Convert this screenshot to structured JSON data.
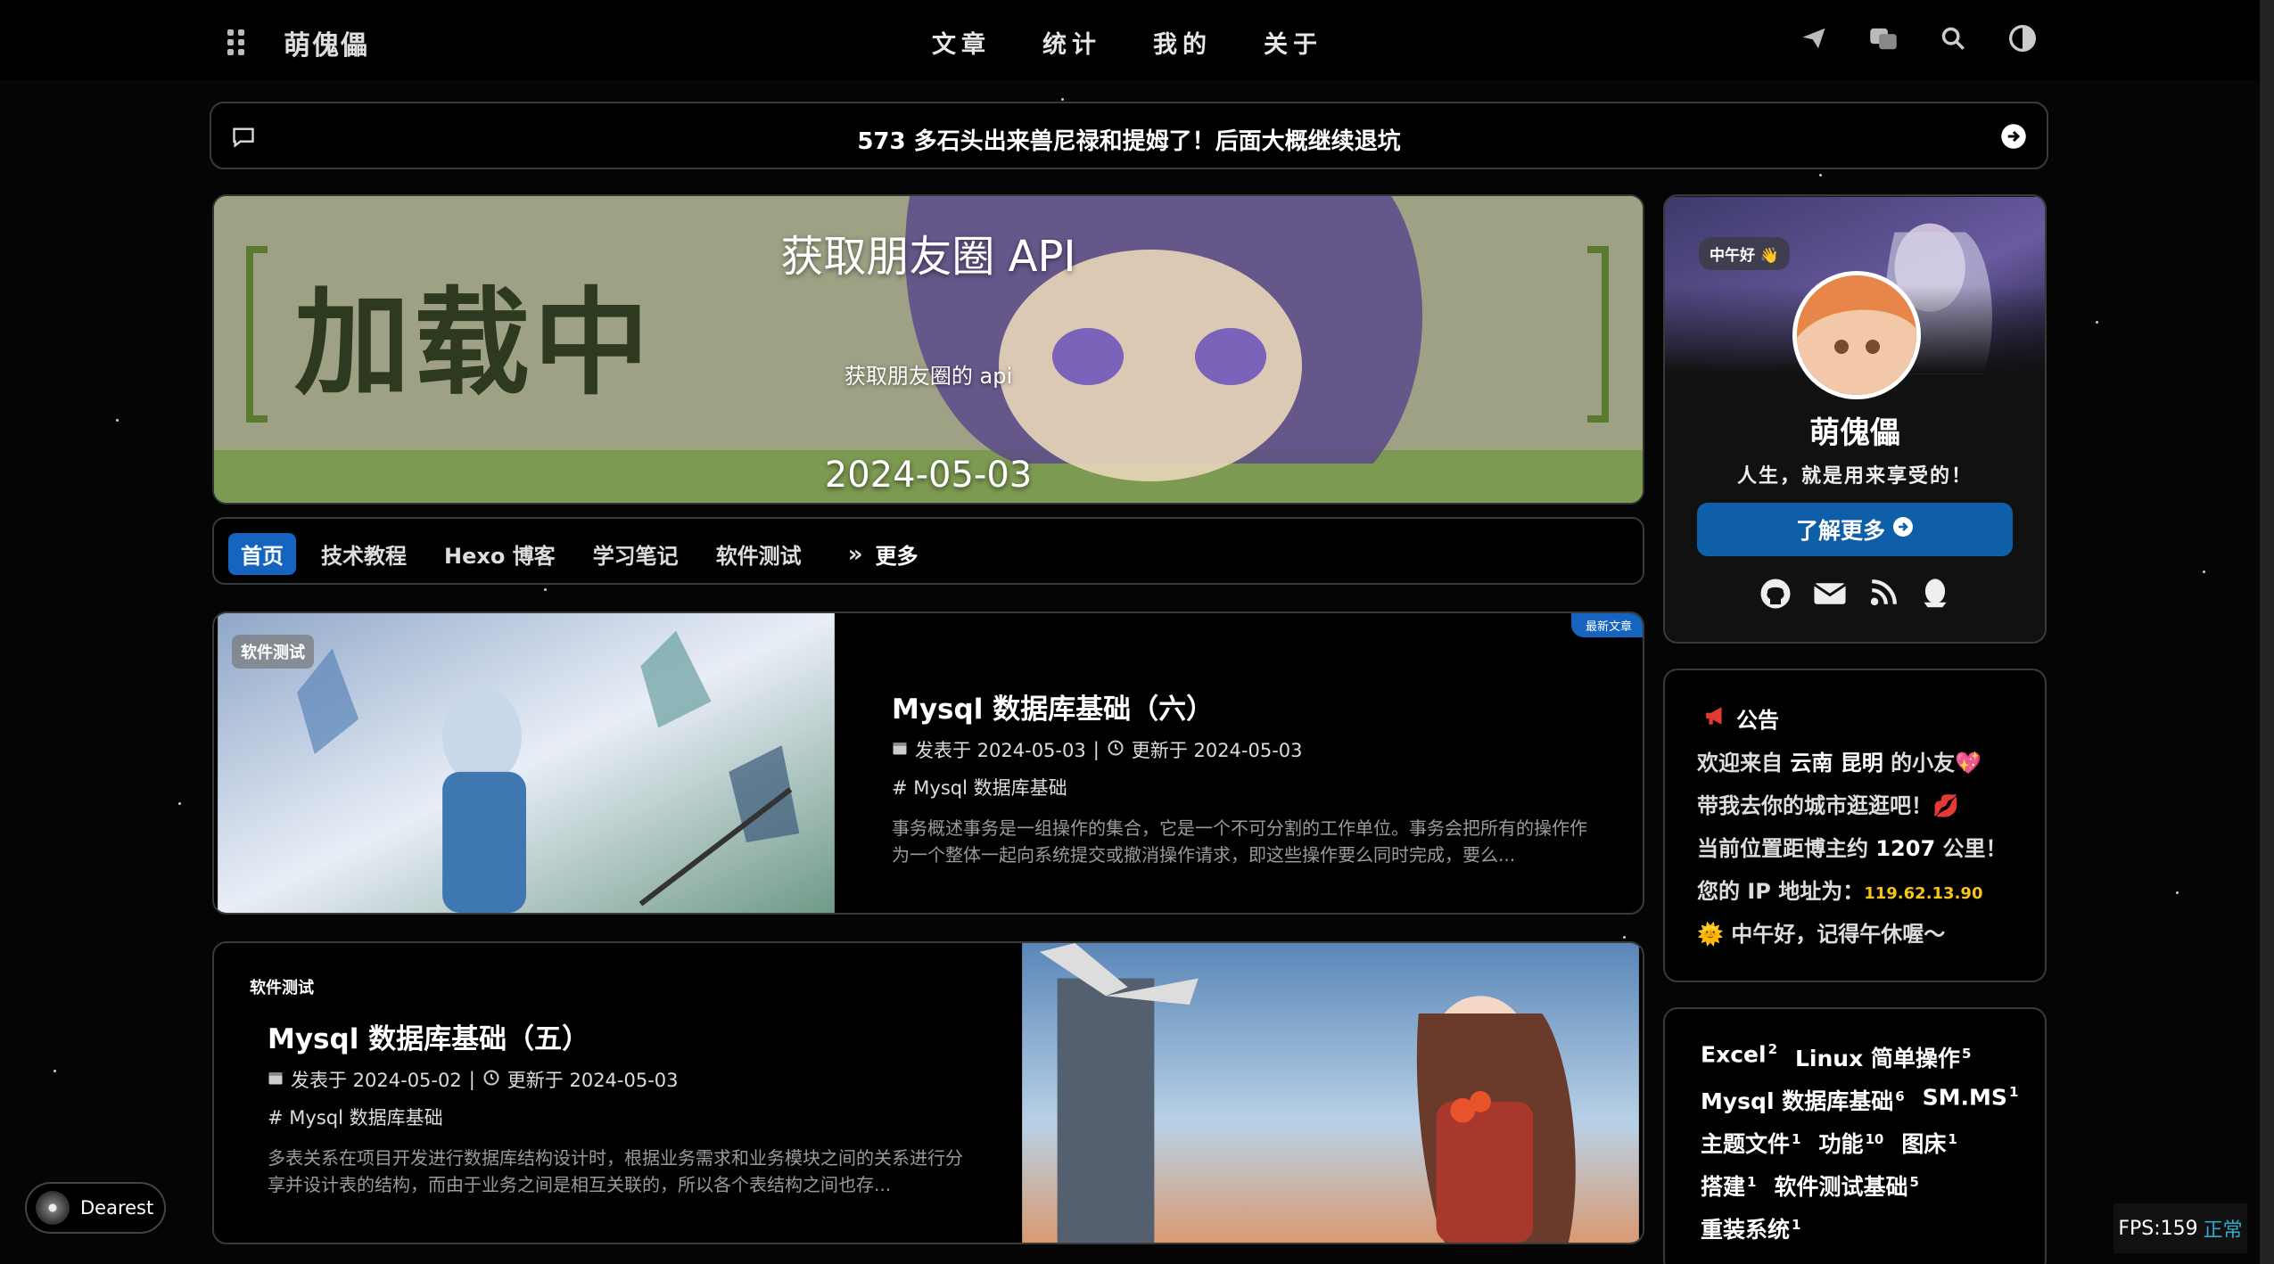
{
  "header": {
    "site_name": "萌傀儡",
    "nav": [
      "文章",
      "统计",
      "我的",
      "关于"
    ]
  },
  "announcement": {
    "text": "573 多石头出来兽尼禄和提姆了！后面大概继续退坑"
  },
  "banner": {
    "title": "获取朋友圈 API",
    "subtitle": "获取朋友圈的 api",
    "date": "2024-05-03",
    "overlay_text": "加载中"
  },
  "categories": {
    "items": [
      "首页",
      "技术教程",
      "Hexo 博客",
      "学习笔记",
      "软件测试"
    ],
    "more": "更多"
  },
  "posts": [
    {
      "tag": "软件测试",
      "badge": "最新文章",
      "title": "Mysql 数据库基础（六）",
      "published": "发表于 2024-05-03",
      "updated": "更新于 2024-05-03",
      "category": "Mysql 数据库基础",
      "excerpt": "事务概述事务是一组操作的集合，它是一个不可分割的工作单位。事务会把所有的操作作为一个整体一起向系统提交或撤消操作请求，即这些操作要么同时完成，要么..."
    },
    {
      "tag": "软件测试",
      "title": "Mysql 数据库基础（五）",
      "published": "发表于 2024-05-02",
      "updated": "更新于 2024-05-03",
      "category": "Mysql 数据库基础",
      "excerpt": "多表关系在项目开发进行数据库结构设计时，根据业务需求和业务模块之间的关系进行分享并设计表的结构，而由于业务之间是相互关联的，所以各个表结构之间也存..."
    }
  ],
  "profile": {
    "greeting": "中午好 👋",
    "name": "萌傀儡",
    "motto": "人生，就是用来享受的！",
    "button": "了解更多"
  },
  "notice": {
    "title": "公告",
    "line1_prefix": "欢迎来自 ",
    "line1_location": "云南 昆明",
    "line1_suffix": " 的小友💖",
    "line2": "带我去你的城市逛逛吧！💋",
    "line3_prefix": "当前位置距博主约 ",
    "line3_distance": "1207",
    "line3_suffix": " 公里！",
    "line4_prefix": "您的 IP 地址为：",
    "line4_ip": "119.62.13.90",
    "line5": "🌞 中午好，记得午休喔～"
  },
  "tags": [
    [
      {
        "name": "Excel",
        "count": "2"
      },
      {
        "name": "Linux 简单操作",
        "count": "5"
      }
    ],
    [
      {
        "name": "Mysql 数据库基础",
        "count": "6"
      },
      {
        "name": "SM.MS",
        "count": "1"
      }
    ],
    [
      {
        "name": "主题文件",
        "count": "1"
      },
      {
        "name": "功能",
        "count": "10"
      },
      {
        "name": "图床",
        "count": "1"
      }
    ],
    [
      {
        "name": "搭建",
        "count": "1"
      },
      {
        "name": "软件测试基础",
        "count": "5"
      }
    ],
    [
      {
        "name": "重装系统",
        "count": "1"
      }
    ]
  ],
  "player": {
    "name": "Dearest"
  },
  "fps": {
    "label": "FPS:159",
    "status": "正常"
  },
  "colors": {
    "accent": "#1565c0",
    "bg": "#050505",
    "ip_yellow": "#f5c518"
  }
}
